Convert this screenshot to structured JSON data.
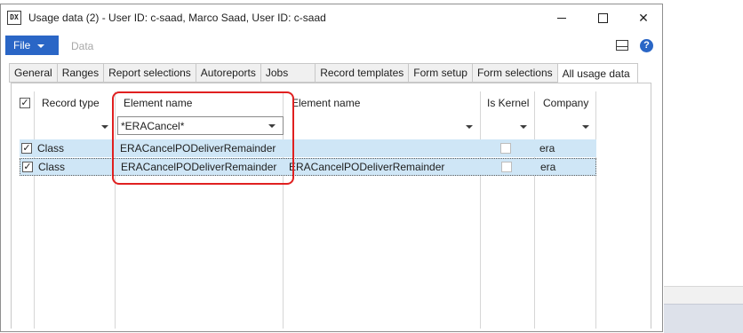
{
  "window": {
    "title": "Usage data (2) - User ID: c-saad, Marco Saad, User ID: c-saad",
    "icon_label": "DX"
  },
  "menu": {
    "file_label": "File",
    "data_label": "Data"
  },
  "tabs": [
    {
      "label": "General"
    },
    {
      "label": "Ranges"
    },
    {
      "label": "Report selections"
    },
    {
      "label": "Autoreports"
    },
    {
      "label": "Jobs"
    },
    {
      "label": "Record templates"
    },
    {
      "label": "Form setup"
    },
    {
      "label": "Form selections"
    },
    {
      "label": "All usage data",
      "active": true
    }
  ],
  "grid": {
    "columns": {
      "record_type": "Record type",
      "element_name": "Element name",
      "element_name_2": "Element name",
      "is_kernel": "Is Kernel",
      "company": "Company"
    },
    "filter": {
      "element_name_value": "*ERACancel*"
    },
    "rows": [
      {
        "record_type": "Class",
        "element_name": "ERACancelPODeliverRemainder",
        "element_name_2": "",
        "company": "era",
        "checked": true
      },
      {
        "record_type": "Class",
        "element_name": "ERACancelPODeliverRemainder",
        "element_name_2": "ERACancelPODeliverRemainder",
        "company": "era",
        "checked": true
      }
    ]
  },
  "colors": {
    "accent": "#2a66c6",
    "selected_row": "#cfe6f6",
    "highlight_border": "#e02020"
  }
}
